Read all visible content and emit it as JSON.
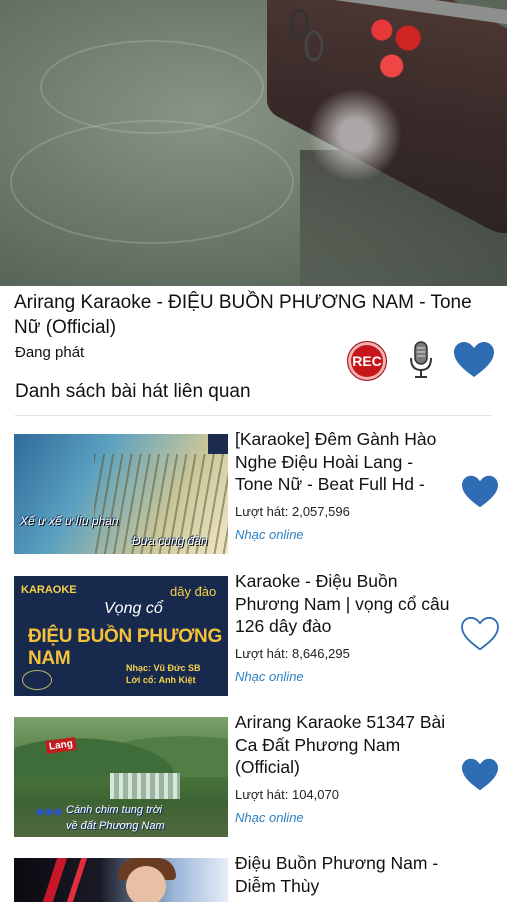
{
  "now_playing": {
    "title": "Arirang Karaoke - ĐIỆU BUỒN PHƯƠNG NAM - Tone Nữ (Official)",
    "status": "Đang phát",
    "rec_label": "REC",
    "record_icon": "record-icon",
    "mic_icon": "microphone-icon",
    "favorite_icon": "heart-icon",
    "favorite_active": true
  },
  "related": {
    "heading": "Danh sách bài hát liên quan",
    "items": [
      {
        "title": "[Karaoke] Đêm Gành Hào Nghe Điệu Hoài Lang - Tone Nữ - Beat Full Hd -",
        "plays": "Lượt hát: 2,057,596",
        "category": "Nhạc online",
        "favorited": true,
        "thumb_text": [
          "Xế ư xế ư líu phạn",
          "Đưa cung đàn"
        ]
      },
      {
        "title": "Karaoke - Điệu Buồn Phương Nam | vọng cổ câu 126 dây đào",
        "plays": "Lượt hát: 8,646,295",
        "category": "Nhạc online",
        "favorited": false,
        "thumb_text": [
          "KARAOKE",
          "dây đào",
          "Vọng cổ",
          "ĐIỆU BUỒN PHƯƠNG NAM",
          "Nhạc: Vũ Đức SB",
          "Lời cổ: Anh Kiệt"
        ]
      },
      {
        "title": "Arirang Karaoke 51347 Bài Ca Đất Phương Nam (Official)",
        "plays": "Lượt hát: 104,070",
        "category": "Nhạc online",
        "favorited": true,
        "thumb_text": [
          "Lang",
          "Cánh chim tung trời",
          "về đất Phương Nam"
        ]
      },
      {
        "title": "Điệu Buồn Phương Nam - Diễm Thùy",
        "plays": "",
        "category": "",
        "favorited": false,
        "thumb_text": []
      }
    ]
  },
  "colors": {
    "heart_blue": "#2e6db4",
    "rec_red": "#c7161a",
    "category_blue": "#2a7fc0"
  }
}
